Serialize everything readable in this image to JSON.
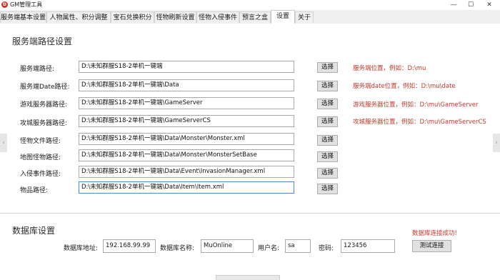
{
  "window": {
    "title": "GM管理工具",
    "icon_text": "D",
    "minimize": "—",
    "maximize": "☐",
    "close": "✕"
  },
  "tabs": [
    {
      "label": "服务端基本设置"
    },
    {
      "label": "人物属性、积分调整"
    },
    {
      "label": "宝石兑换积分"
    },
    {
      "label": "怪物刷新设置"
    },
    {
      "label": "怪物入侵事件"
    },
    {
      "label": "预言之盒"
    },
    {
      "label": "设置"
    },
    {
      "label": "关于"
    }
  ],
  "path_section": {
    "title": "服务端路径设置",
    "choose_label": "选择",
    "rows": [
      {
        "label": "服务端路径:",
        "value": "D:\\未知群服S18-2单机一键端",
        "hint": "服务端位置，例如：D:\\mu"
      },
      {
        "label": "服务端Date路径:",
        "value": "D:\\未知群服S18-2单机一键端\\Data",
        "hint": "服务端date位置，例如：D:\\mu\\date"
      },
      {
        "label": "游戏服务器路径:",
        "value": "D:\\未知群服S18-2单机一键端\\GameServer",
        "hint": "游戏服务器位置，例如：D:\\mu\\GameServer"
      },
      {
        "label": "攻城服务器路径:",
        "value": "D:\\未知群服S18-2单机一键端\\GameServerCS",
        "hint": "攻城服务器位置，例如：D:\\mu\\GameServerCS"
      },
      {
        "label": "怪物文件路径:",
        "value": "D:\\未知群服S18-2单机一键端\\Data\\Monster\\Monster.xml",
        "hint": ""
      },
      {
        "label": "地图怪物路径:",
        "value": "D:\\未知群服S18-2单机一键端\\Data\\Monster\\MonsterSetBase",
        "hint": ""
      },
      {
        "label": "入侵事件路径:",
        "value": "D:\\未知群服S18-2单机一键端\\Data\\Event\\InvasionManager.xml",
        "hint": ""
      },
      {
        "label": "物品路径:",
        "value": "D:\\未知群服S18-2单机一键端\\Data\\Item\\Item.xml",
        "hint": ""
      }
    ]
  },
  "db_section": {
    "title": "数据库设置",
    "address_label": "数据库地址:",
    "address_value": "192.168.99.99",
    "name_label": "数据库名称:",
    "name_value": "MuOnline",
    "user_label": "用户名:",
    "user_value": "sa",
    "password_label": "密码:",
    "password_value": "123456",
    "status": "数据库连接成功!",
    "test_button": "测试连接"
  },
  "nav": {
    "left": "‹",
    "right": "›"
  },
  "colors": {
    "hint_red": "#c0392b",
    "panel_bg": "#ffffff",
    "app_bg": "#f0f0f0"
  }
}
